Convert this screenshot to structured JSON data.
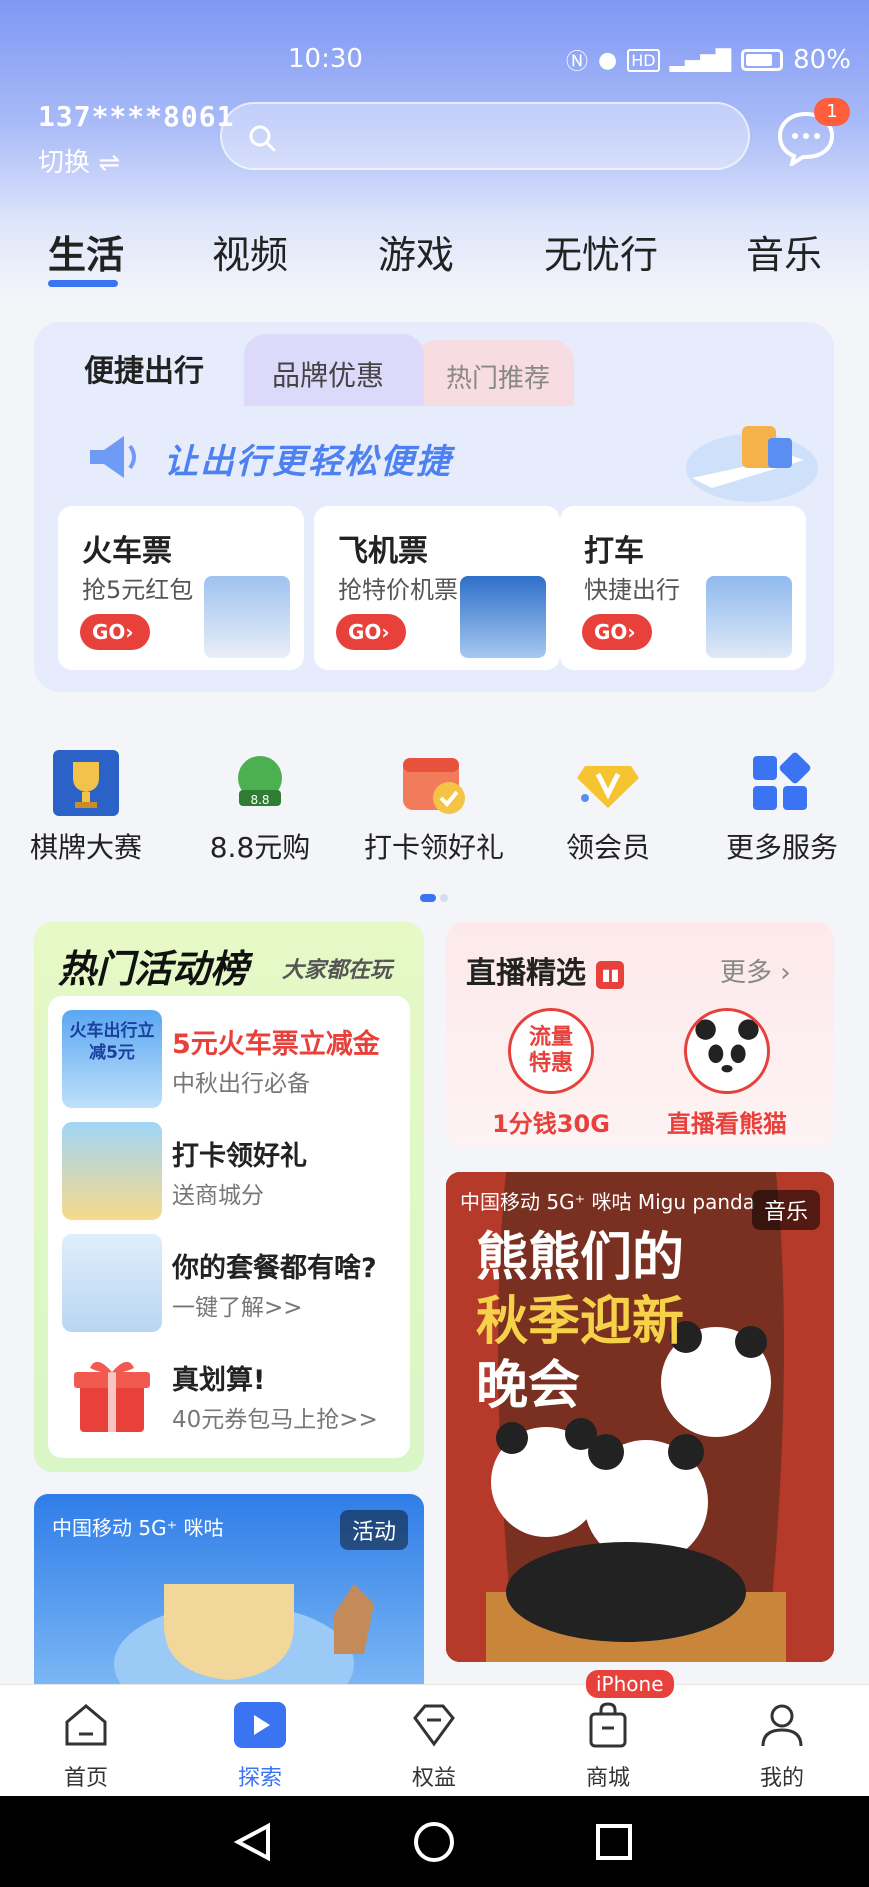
{
  "status": {
    "time": "10:30",
    "battery": "80%"
  },
  "header": {
    "phone": "137****8061",
    "switch_label": "切换 ⇌",
    "search_placeholder": "",
    "message_badge": "1"
  },
  "tabs": [
    {
      "label": "生活",
      "active": true
    },
    {
      "label": "视频"
    },
    {
      "label": "游戏"
    },
    {
      "label": "无忧行"
    },
    {
      "label": "音乐"
    }
  ],
  "travel": {
    "tabs": [
      "便捷出行",
      "品牌优惠",
      "热门推荐"
    ],
    "banner": "让出行更轻松便捷",
    "cards": [
      {
        "title": "火车票",
        "subtitle": "抢5元红包",
        "go": "GO›"
      },
      {
        "title": "飞机票",
        "subtitle": "抢特价机票",
        "go": "GO›"
      },
      {
        "title": "打车",
        "subtitle": "快捷出行",
        "go": "GO›"
      }
    ]
  },
  "services": [
    {
      "label": "棋牌大赛",
      "icon": "trophy-icon"
    },
    {
      "label": "8.8元购",
      "icon": "gift-icon"
    },
    {
      "label": "打卡领好礼",
      "icon": "calendar-check-icon"
    },
    {
      "label": "领会员",
      "icon": "vip-diamond-icon"
    },
    {
      "label": "更多服务",
      "icon": "grid-icon"
    }
  ],
  "hot": {
    "title": "热门活动榜",
    "subtitle": "大家都在玩",
    "items": [
      {
        "title": "5元火车票立减金",
        "desc": "中秋出行必备",
        "highlight": true,
        "pic_text": "火车出行立减5元"
      },
      {
        "title": "打卡领好礼",
        "desc": "送商城分"
      },
      {
        "title": "你的套餐都有啥?",
        "desc": "一键了解>>"
      },
      {
        "title": "真划算!",
        "desc": "40元券包马上抢>>"
      }
    ]
  },
  "live": {
    "title": "直播精选",
    "more": "更多 ›",
    "items": [
      {
        "caption": "1分钱30G",
        "circle_text": "流量特惠"
      },
      {
        "caption": "直播看熊猫"
      }
    ]
  },
  "poster": {
    "tag": "音乐",
    "logos": "中国移动 5G⁺ 咪咕 Migu panda",
    "title_line1": "熊熊们的",
    "title_line2": "秋季迎新",
    "title_line3": "晚会"
  },
  "activity": {
    "tag": "活动",
    "logos": "中国移动 5G⁺ 咪咕"
  },
  "nav": [
    {
      "label": "首页",
      "icon": "home-icon"
    },
    {
      "label": "探索",
      "icon": "explore-play-icon",
      "active": true
    },
    {
      "label": "权益",
      "icon": "diamond-icon"
    },
    {
      "label": "商城",
      "icon": "shopping-bag-icon",
      "tag": "iPhone"
    },
    {
      "label": "我的",
      "icon": "profile-icon"
    }
  ],
  "colors": {
    "accent": "#3b74f3",
    "red": "#e8413b",
    "header_top": "#7f98f4"
  }
}
